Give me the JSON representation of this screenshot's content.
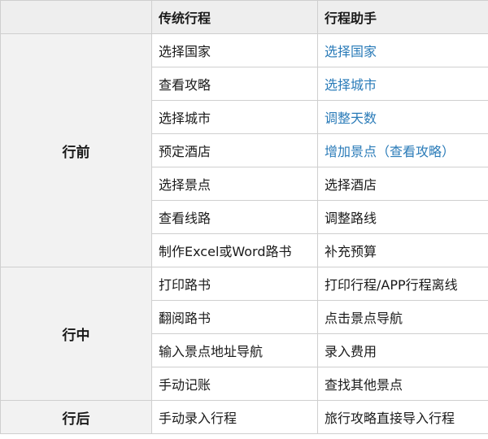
{
  "header": {
    "corner": "",
    "col_traditional": "传统行程",
    "col_assistant": "行程助手"
  },
  "phases": {
    "before": "行前",
    "during": "行中",
    "after": "行后"
  },
  "rows": [
    {
      "traditional": "选择国家",
      "assistant": "选择国家"
    },
    {
      "traditional": "查看攻略",
      "assistant": "选择城市"
    },
    {
      "traditional": "选择城市",
      "assistant": "调整天数"
    },
    {
      "traditional": "预定酒店",
      "assistant": "增加景点（查看攻略）"
    },
    {
      "traditional": "选择景点",
      "assistant": "选择酒店"
    },
    {
      "traditional": "查看线路",
      "assistant": "调整路线"
    },
    {
      "traditional": "制作Excel或Word路书",
      "assistant": "补充预算"
    },
    {
      "traditional": "打印路书",
      "assistant": "打印行程/APP行程离线"
    },
    {
      "traditional": "翻阅路书",
      "assistant": "点击景点导航"
    },
    {
      "traditional": "输入景点地址导航",
      "assistant": "录入费用"
    },
    {
      "traditional": "手动记账",
      "assistant": "查找其他景点"
    },
    {
      "traditional": "手动录入行程",
      "assistant": "旅行攻略直接导入行程"
    }
  ],
  "colors": {
    "link": "#2a7bb8",
    "header_bg": "#eeeeee",
    "phase_bg": "#f2f2f2",
    "border": "#cfcfcf"
  }
}
